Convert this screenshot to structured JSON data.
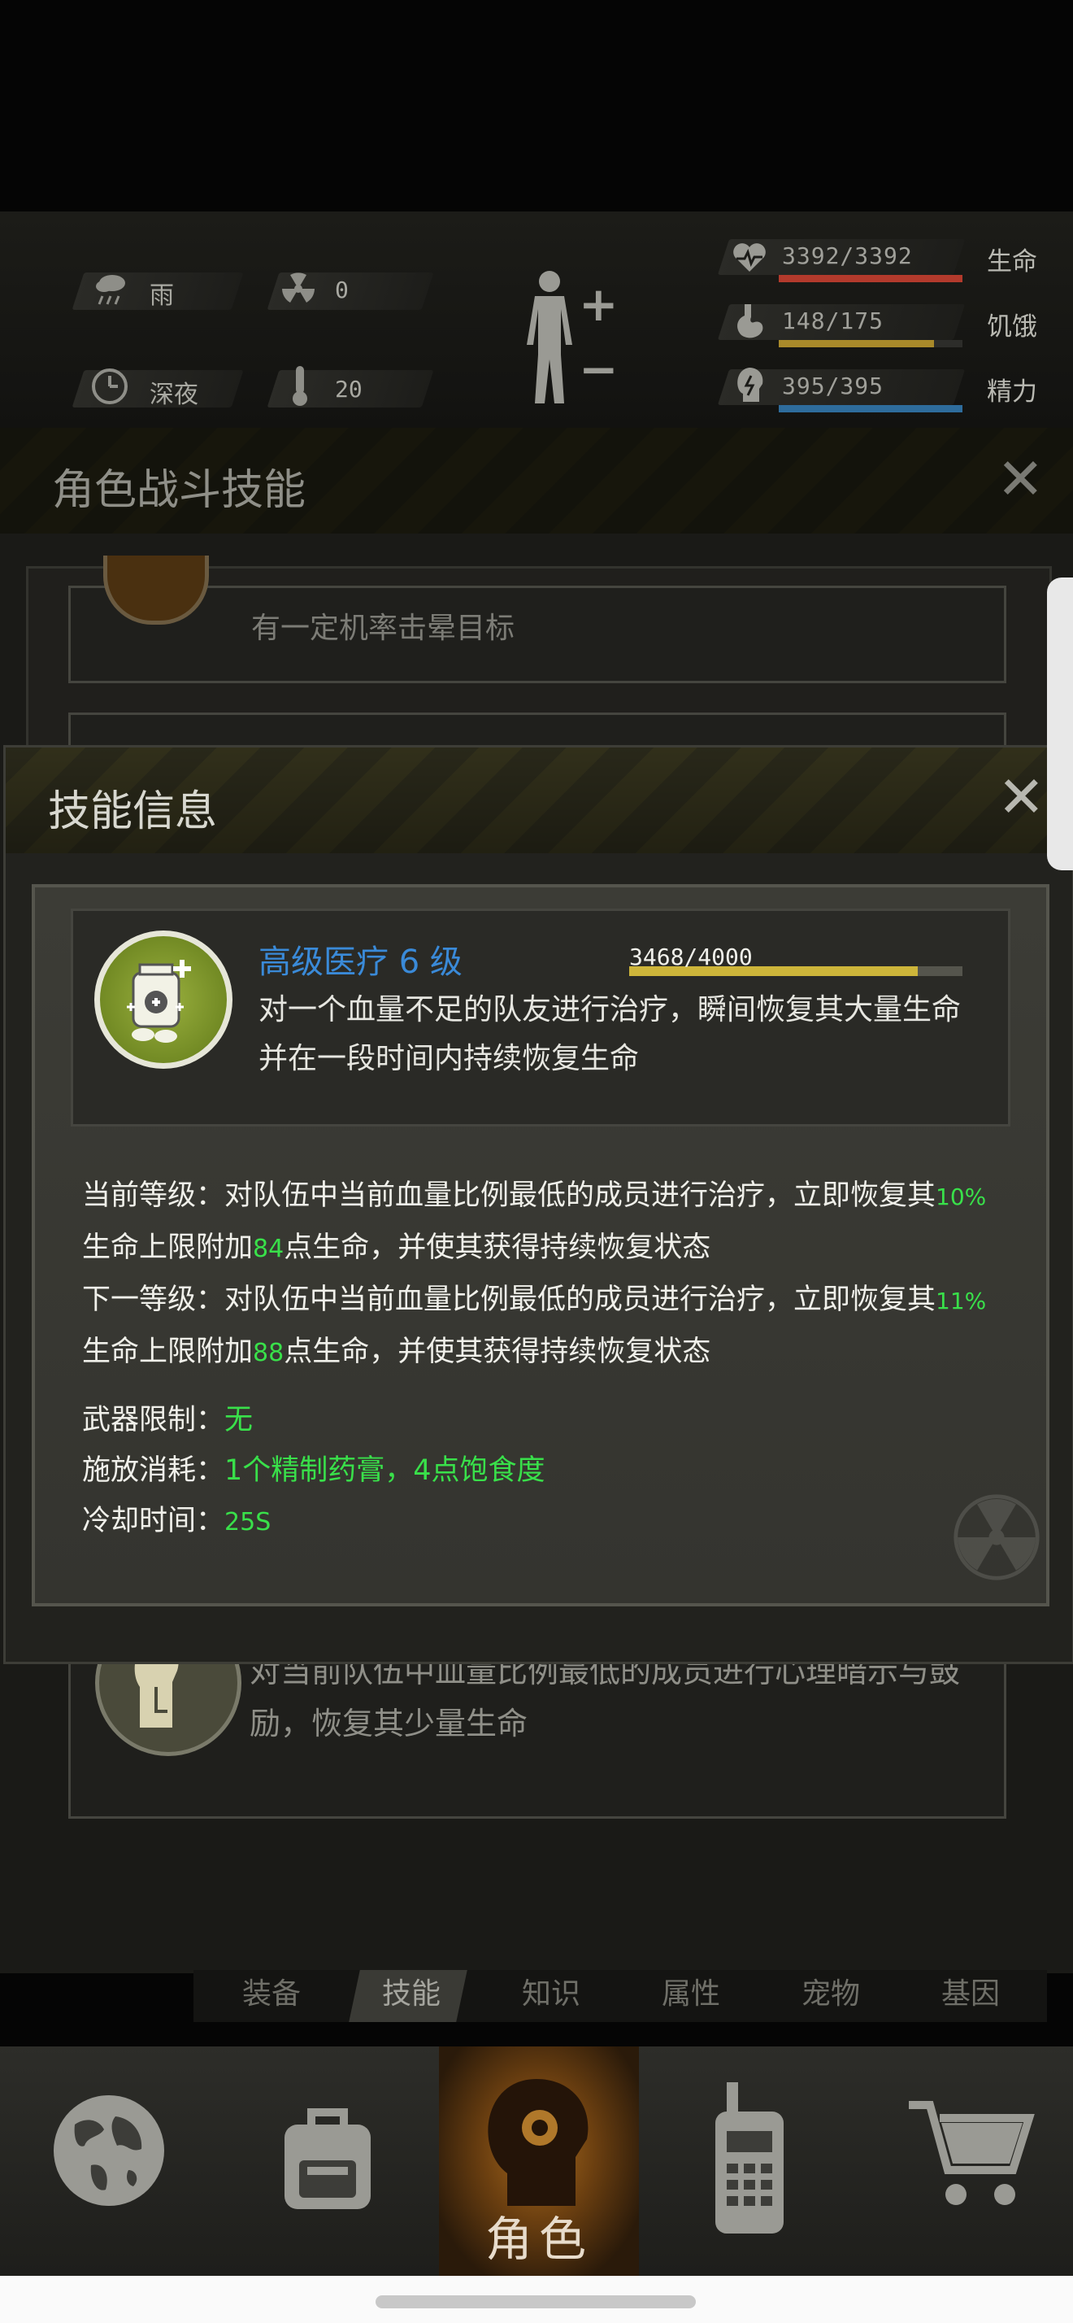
{
  "hud": {
    "weather": "雨",
    "radiation": "0",
    "time_of_day": "深夜",
    "temperature": "20",
    "health": {
      "label": "生命",
      "value": "3392/3392",
      "fraction": 1.0,
      "color": "#b33a2c"
    },
    "hunger": {
      "label": "饥饿",
      "value": "148/175",
      "fraction": 0.846,
      "color": "#a98a2a"
    },
    "energy": {
      "label": "精力",
      "value": "395/395",
      "fraction": 1.0,
      "color": "#2e6c9c"
    },
    "plus_symbol": "+",
    "minus_symbol": "−"
  },
  "combat_panel": {
    "title": "角色战斗技能",
    "close": "✕",
    "skill_top_desc": "有一定机率击晕目标",
    "skill_bottom_desc": "对当前队伍中血量比例最低的成员进行心理暗示与鼓励，恢复其少量生命"
  },
  "skill_info": {
    "title": "技能信息",
    "close": "✕",
    "name": "高级医疗 6 级",
    "xp": "3468/4000",
    "xp_fraction": 0.867,
    "description": "对一个血量不足的队友进行治疗，瞬间恢复其大量生命并在一段时间内持续恢复生命",
    "current_label": "当前等级：",
    "current_text_a": "对队伍中当前血量比例最低的成员进行治疗，立即恢复其",
    "current_pct": "10%",
    "current_text_b": "生命上限附加",
    "current_points": "84",
    "current_text_c": "点生命，并使其获得持续恢复状态",
    "next_label": "下一等级：",
    "next_text_a": "对队伍中当前血量比例最低的成员进行治疗，立即恢复其",
    "next_pct": "11%",
    "next_text_b": "生命上限附加",
    "next_points": "88",
    "next_text_c": "点生命，并使其获得持续恢复状态",
    "weapon_label": "武器限制：",
    "weapon_value": "无",
    "cost_label": "施放消耗：",
    "cost_value": "1个精制药膏，4点饱食度",
    "cooldown_label": "冷却时间：",
    "cooldown_value": "25S"
  },
  "tabs": [
    "装备",
    "技能",
    "知识",
    "属性",
    "宠物",
    "基因"
  ],
  "nav": {
    "active_label": "角色"
  },
  "colors": {
    "accent_blue": "#3a8ad8",
    "green": "#39e04a",
    "xp_bar": "#cdb53a"
  }
}
